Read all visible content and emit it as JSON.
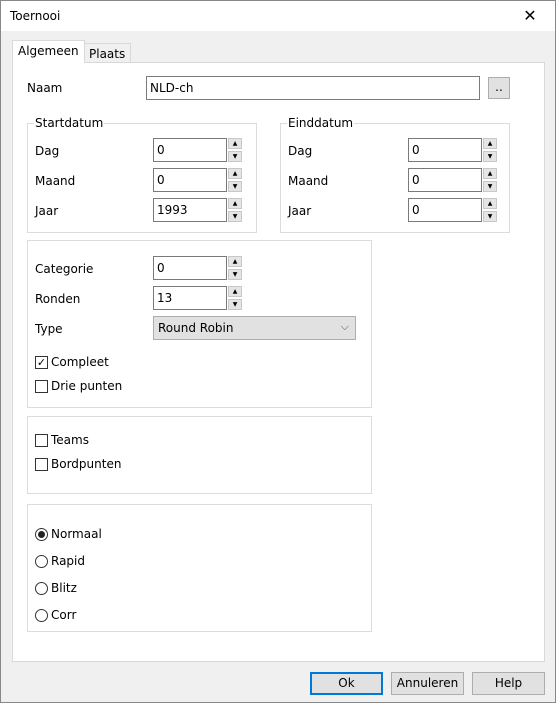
{
  "window": {
    "title": "Toernooi",
    "close_icon": "close-icon"
  },
  "tabs": [
    {
      "label": "Algemeen",
      "selected": true
    },
    {
      "label": "Plaats",
      "selected": false
    }
  ],
  "naam": {
    "label": "Naam",
    "value": "NLD-ch",
    "browse_label": ".."
  },
  "startdatum": {
    "title": "Startdatum",
    "dag_label": "Dag",
    "dag": "0",
    "maand_label": "Maand",
    "maand": "0",
    "jaar_label": "Jaar",
    "jaar": "1993"
  },
  "einddatum": {
    "title": "Einddatum",
    "dag_label": "Dag",
    "dag": "0",
    "maand_label": "Maand",
    "maand": "0",
    "jaar_label": "Jaar",
    "jaar": "0"
  },
  "details": {
    "categorie_label": "Categorie",
    "categorie": "0",
    "ronden_label": "Ronden",
    "ronden": "13",
    "type_label": "Type",
    "type": "Round Robin",
    "compleet_label": "Compleet",
    "compleet": true,
    "drie_punten_label": "Drie punten",
    "drie_punten": false
  },
  "teams": {
    "teams_label": "Teams",
    "teams": false,
    "bordpunten_label": "Bordpunten",
    "bordpunten": false
  },
  "speed": {
    "options": [
      "Normaal",
      "Rapid",
      "Blitz",
      "Corr"
    ],
    "selected": "Normaal"
  },
  "buttons": {
    "ok": "Ok",
    "cancel": "Annuleren",
    "help": "Help"
  },
  "colors": {
    "accent": "#0078d7"
  }
}
